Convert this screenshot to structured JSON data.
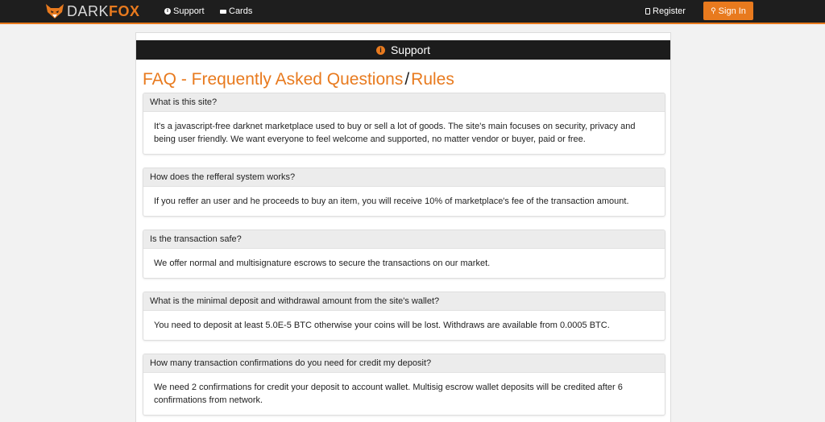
{
  "navbar": {
    "brand_dark": "DARK",
    "brand_fox": "FOX",
    "links": [
      {
        "label": "Support",
        "icon": "info-icon"
      },
      {
        "label": "Cards",
        "icon": "card-icon"
      }
    ],
    "register_label": "Register",
    "signin_label": "Sign In",
    "accent_color": "#e87a1e"
  },
  "panel": {
    "header_title": "Support",
    "page_title_main": "FAQ - Frequently Asked Questions",
    "page_title_sep": "/",
    "page_title_rules": "Rules"
  },
  "faq": [
    {
      "question": "What is this site?",
      "answer": "It's a javascript-free darknet marketplace used to buy or sell a lot of goods. The site's main focuses on security, privacy and being user friendly. We want everyone to feel welcome and supported, no matter vendor or buyer, paid or free."
    },
    {
      "question": "How does the refferal system works?",
      "answer": "If you reffer an user and he proceeds to buy an item, you will receive 10% of marketplace's fee of the transaction amount."
    },
    {
      "question": "Is the transaction safe?",
      "answer": "We offer normal and multisignature escrows to secure the transactions on our market."
    },
    {
      "question": "What is the minimal deposit and withdrawal amount from the site's wallet?",
      "answer": "You need to deposit at least 5.0E-5 BTC otherwise your coins will be lost. Withdraws are available from 0.0005 BTC."
    },
    {
      "question": "How many transaction confirmations do you need for credit my deposit?",
      "answer": "We need 2 confirmations for credit your deposit to account wallet. Multisig escrow wallet deposits will be credited after 6 confirmations from network."
    }
  ]
}
